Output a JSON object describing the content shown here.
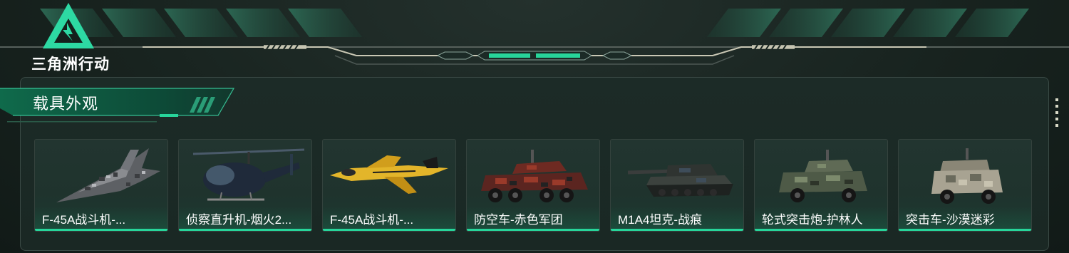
{
  "brand": {
    "name": "三角洲行动"
  },
  "section": {
    "title": "载具外观"
  },
  "colors": {
    "accent": "#27d59a",
    "bg": "#15211d",
    "panel_border": "#3a4a45"
  },
  "vehicles": [
    {
      "label": "F-45A战斗机-...",
      "icon": "fighter-jet-digital-camo"
    },
    {
      "label": "侦察直升机-烟火2...",
      "icon": "scout-helicopter"
    },
    {
      "label": "F-45A战斗机-...",
      "icon": "fighter-jet-yellow"
    },
    {
      "label": "防空车-赤色军团",
      "icon": "anti-air-vehicle-red-camo"
    },
    {
      "label": "M1A4坦克-战痕",
      "icon": "tank"
    },
    {
      "label": "轮式突击炮-护林人",
      "icon": "wheeled-assault-gun"
    },
    {
      "label": "突击车-沙漠迷彩",
      "icon": "assault-vehicle-desert"
    }
  ]
}
